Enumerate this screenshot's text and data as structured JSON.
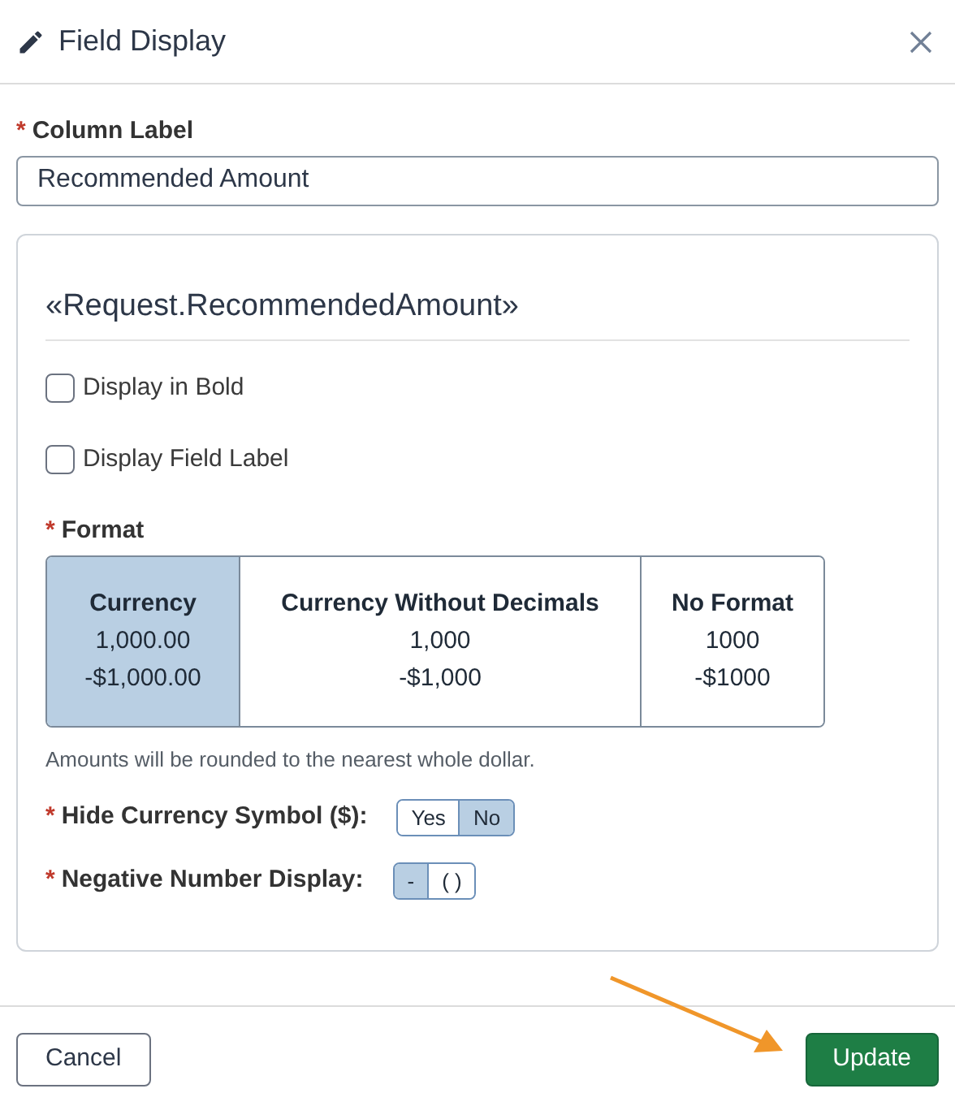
{
  "window": {
    "title": "Field Display"
  },
  "column_label": {
    "label": "Column Label",
    "required_mark": "*",
    "value": "Recommended Amount"
  },
  "field_token": "«Request.RecommendedAmount»",
  "checkboxes": [
    {
      "label": "Display in Bold",
      "checked": false
    },
    {
      "label": "Display Field Label",
      "checked": false
    }
  ],
  "format": {
    "label": "Format",
    "required_mark": "*",
    "options": [
      {
        "title": "Currency",
        "lines": [
          "1,000.00",
          "-$1,000.00"
        ],
        "selected": true
      },
      {
        "title": "Currency Without Decimals",
        "lines": [
          "1,000",
          "-$1,000"
        ],
        "selected": false
      },
      {
        "title": "No Format",
        "lines": [
          "1000",
          "-$1000"
        ],
        "selected": false
      }
    ],
    "note": "Amounts will be rounded to the nearest whole dollar."
  },
  "toggles": [
    {
      "label": "Hide Currency Symbol ($):",
      "required_mark": "*",
      "options": [
        {
          "label": "Yes",
          "selected": false
        },
        {
          "label": "No",
          "selected": true
        }
      ]
    },
    {
      "label": "Negative Number Display:",
      "required_mark": "*",
      "options": [
        {
          "label": "-",
          "selected": true
        },
        {
          "label": "( )",
          "selected": false
        }
      ]
    }
  ],
  "buttons": {
    "cancel": "Cancel",
    "update": "Update"
  }
}
